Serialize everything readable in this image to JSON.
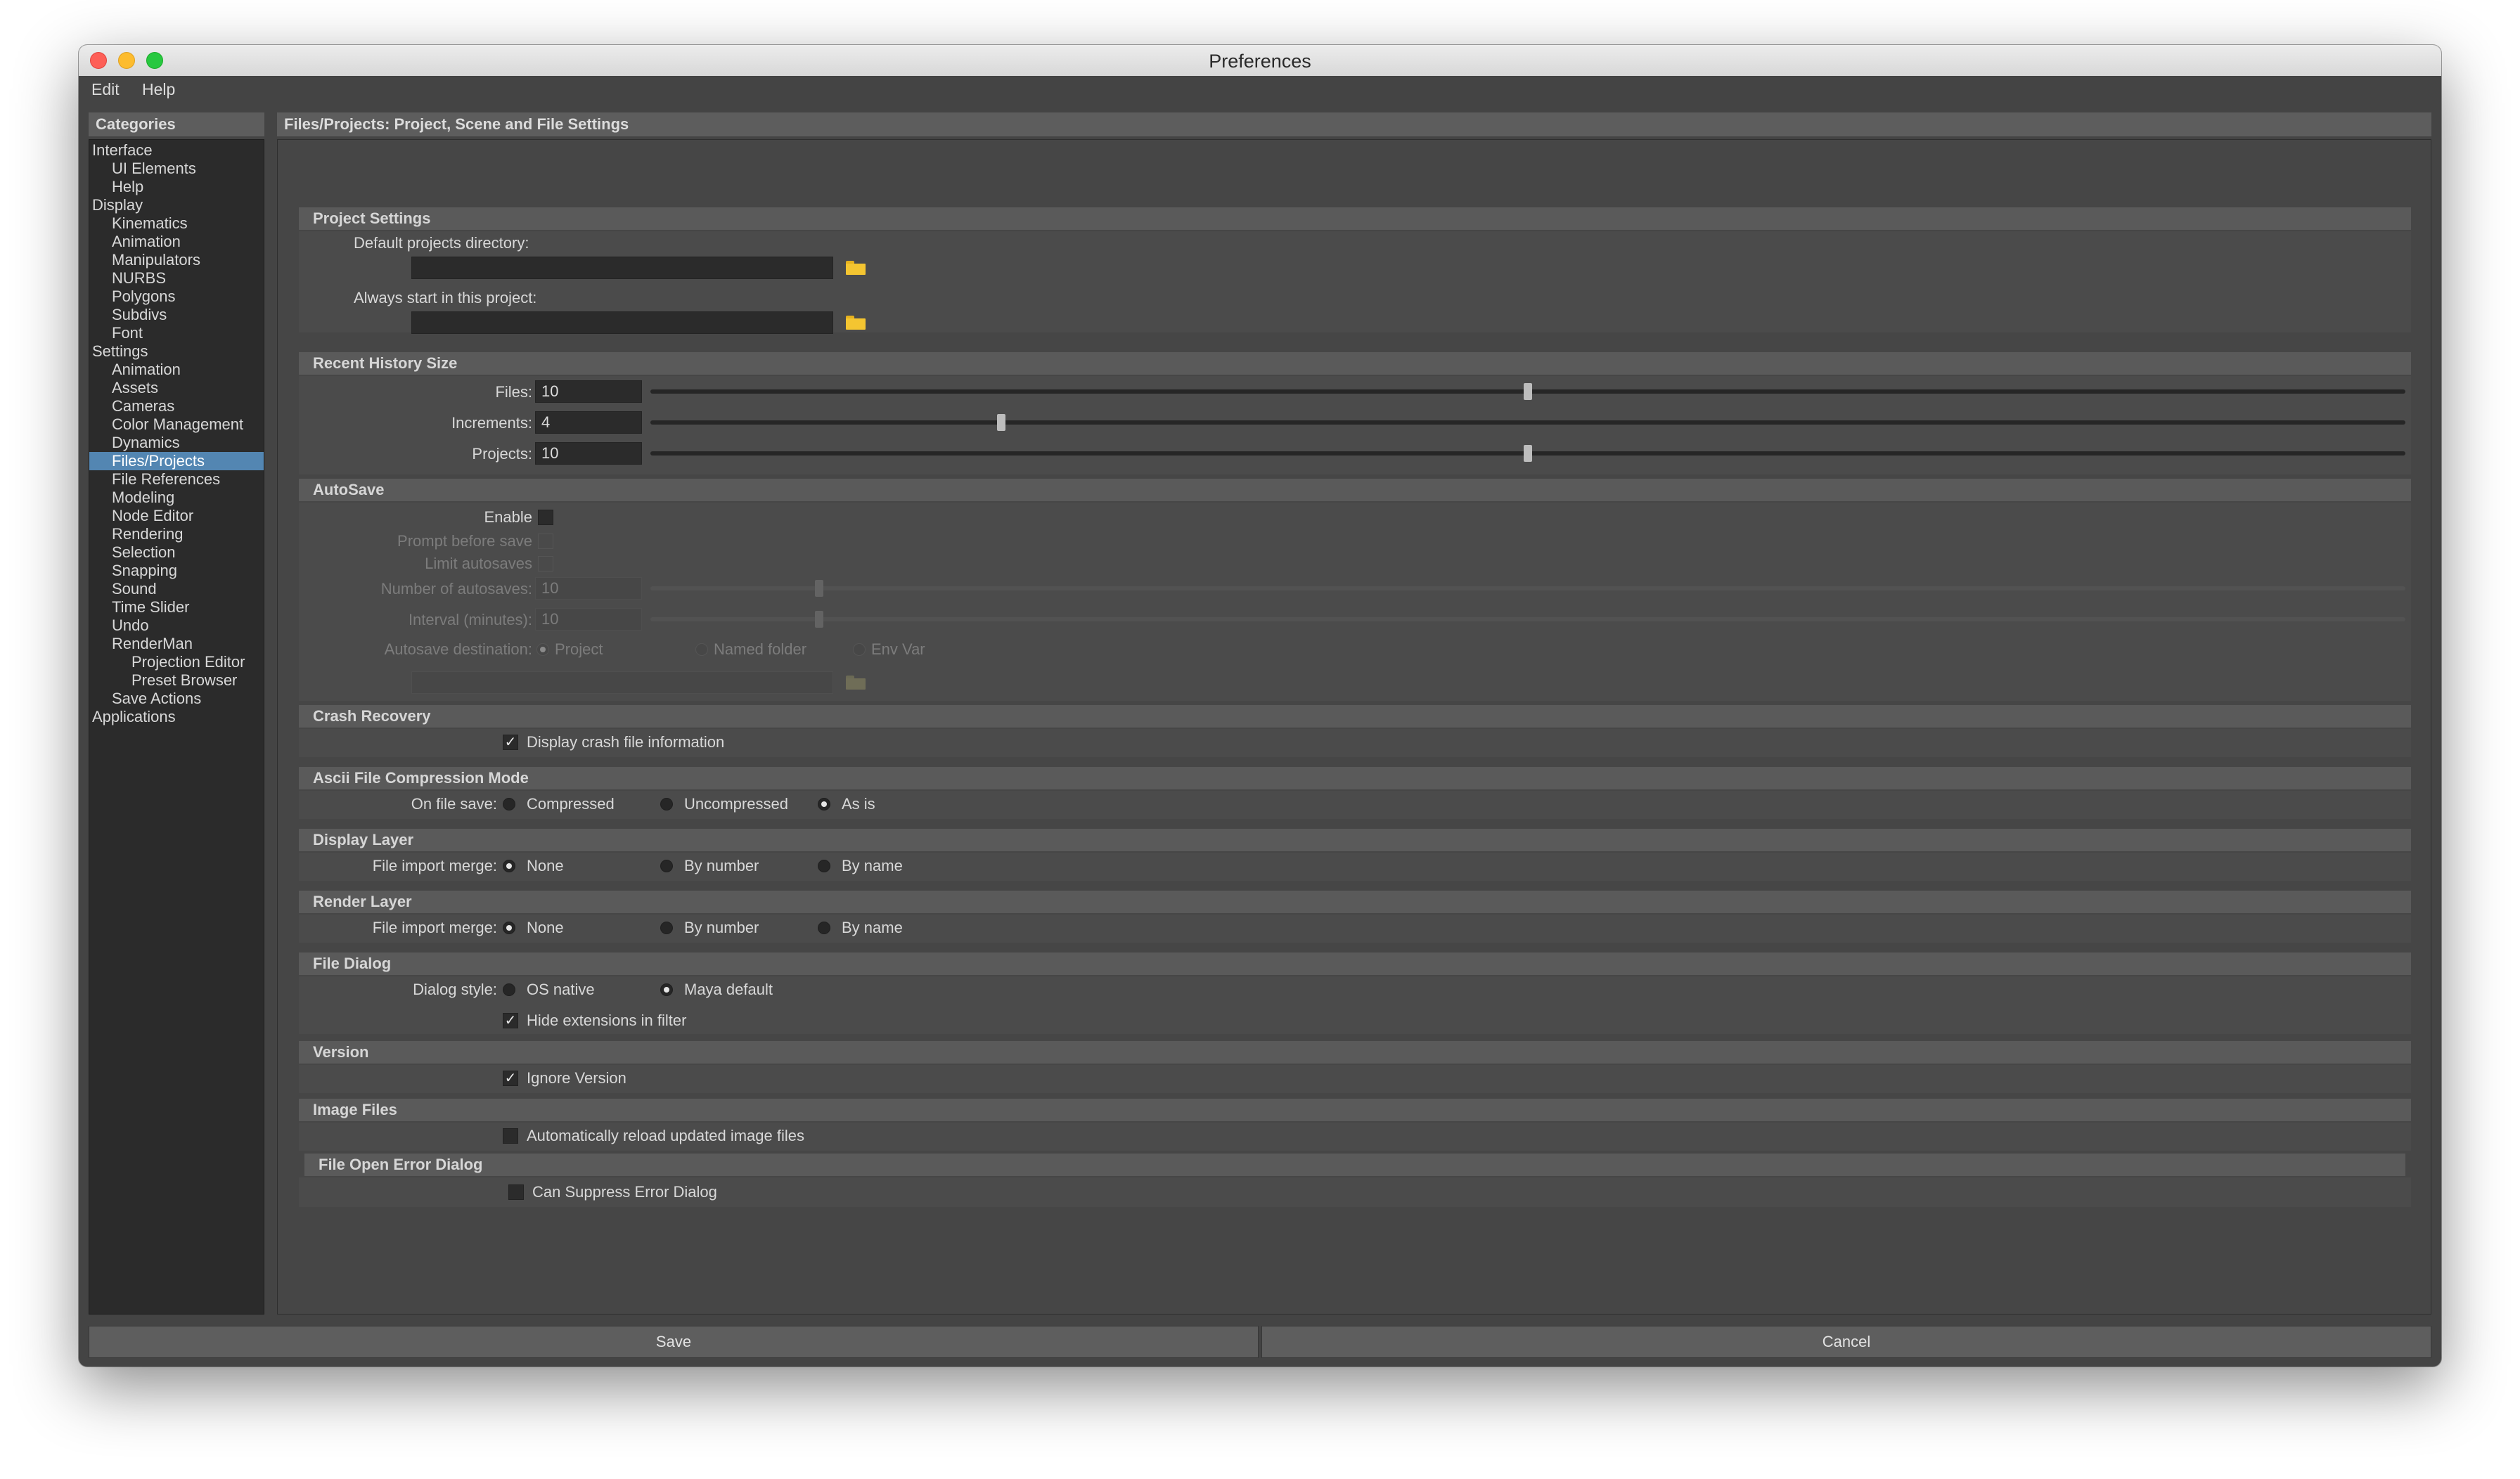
{
  "window": {
    "title": "Preferences"
  },
  "menubar": {
    "edit": "Edit",
    "help": "Help"
  },
  "categories": {
    "header": "Categories",
    "items": [
      {
        "label": "Interface",
        "level": 0
      },
      {
        "label": "UI Elements",
        "level": 1
      },
      {
        "label": "Help",
        "level": 1
      },
      {
        "label": "Display",
        "level": 0
      },
      {
        "label": "Kinematics",
        "level": 1
      },
      {
        "label": "Animation",
        "level": 1
      },
      {
        "label": "Manipulators",
        "level": 1
      },
      {
        "label": "NURBS",
        "level": 1
      },
      {
        "label": "Polygons",
        "level": 1
      },
      {
        "label": "Subdivs",
        "level": 1
      },
      {
        "label": "Font",
        "level": 1
      },
      {
        "label": "Settings",
        "level": 0
      },
      {
        "label": "Animation",
        "level": 1
      },
      {
        "label": "Assets",
        "level": 1
      },
      {
        "label": "Cameras",
        "level": 1
      },
      {
        "label": "Color Management",
        "level": 1
      },
      {
        "label": "Dynamics",
        "level": 1
      },
      {
        "label": "Files/Projects",
        "level": 1,
        "selected": true
      },
      {
        "label": "File References",
        "level": 1
      },
      {
        "label": "Modeling",
        "level": 1
      },
      {
        "label": "Node Editor",
        "level": 1
      },
      {
        "label": "Rendering",
        "level": 1
      },
      {
        "label": "Selection",
        "level": 1
      },
      {
        "label": "Snapping",
        "level": 1
      },
      {
        "label": "Sound",
        "level": 1
      },
      {
        "label": "Time Slider",
        "level": 1
      },
      {
        "label": "Undo",
        "level": 1
      },
      {
        "label": "RenderMan",
        "level": 1
      },
      {
        "label": "Projection Editor",
        "level": 2
      },
      {
        "label": "Preset Browser",
        "level": 2
      },
      {
        "label": "Save Actions",
        "level": 1
      },
      {
        "label": "Applications",
        "level": 0
      }
    ]
  },
  "main": {
    "header": "Files/Projects: Project, Scene and File Settings",
    "project_settings": {
      "title": "Project Settings",
      "default_dir_label": "Default projects directory:",
      "default_dir_value": "",
      "always_start_label": "Always start in this project:",
      "always_start_value": ""
    },
    "recent_history": {
      "title": "Recent History Size",
      "files_label": "Files:",
      "files_value": "10",
      "files_level": 10,
      "increments_label": "Increments:",
      "increments_value": "4",
      "increments_level": 4,
      "projects_label": "Projects:",
      "projects_value": "10",
      "projects_level": 10
    },
    "autosave": {
      "title": "AutoSave",
      "enable_label": "Enable",
      "prompt_label": "Prompt before save",
      "limit_label": "Limit autosaves",
      "number_label": "Number of autosaves:",
      "number_value": "10",
      "interval_label": "Interval (minutes):",
      "interval_value": "10",
      "destination_label": "Autosave destination:",
      "dest_project": "Project",
      "dest_named": "Named folder",
      "dest_env": "Env Var",
      "dest_path_value": ""
    },
    "crash_recovery": {
      "title": "Crash Recovery",
      "display_label": "Display crash file information"
    },
    "ascii": {
      "title": "Ascii File Compression Mode",
      "label": "On file save:",
      "opt_compressed": "Compressed",
      "opt_uncompressed": "Uncompressed",
      "opt_asis": "As is"
    },
    "display_layer": {
      "title": "Display Layer",
      "label": "File import merge:",
      "opt_none": "None",
      "opt_number": "By number",
      "opt_name": "By name"
    },
    "render_layer": {
      "title": "Render Layer",
      "label": "File import merge:",
      "opt_none": "None",
      "opt_number": "By number",
      "opt_name": "By name"
    },
    "file_dialog": {
      "title": "File Dialog",
      "label": "Dialog style:",
      "opt_native": "OS native",
      "opt_maya": "Maya default",
      "hide_ext_label": "Hide extensions in filter"
    },
    "version": {
      "title": "Version",
      "ignore_label": "Ignore Version"
    },
    "image_files": {
      "title": "Image Files",
      "reload_label": "Automatically reload updated image files"
    },
    "file_open_error": {
      "title": "File Open Error Dialog",
      "suppress_label": "Can Suppress Error Dialog"
    }
  },
  "footer": {
    "save_label": "Save",
    "cancel_label": "Cancel"
  }
}
